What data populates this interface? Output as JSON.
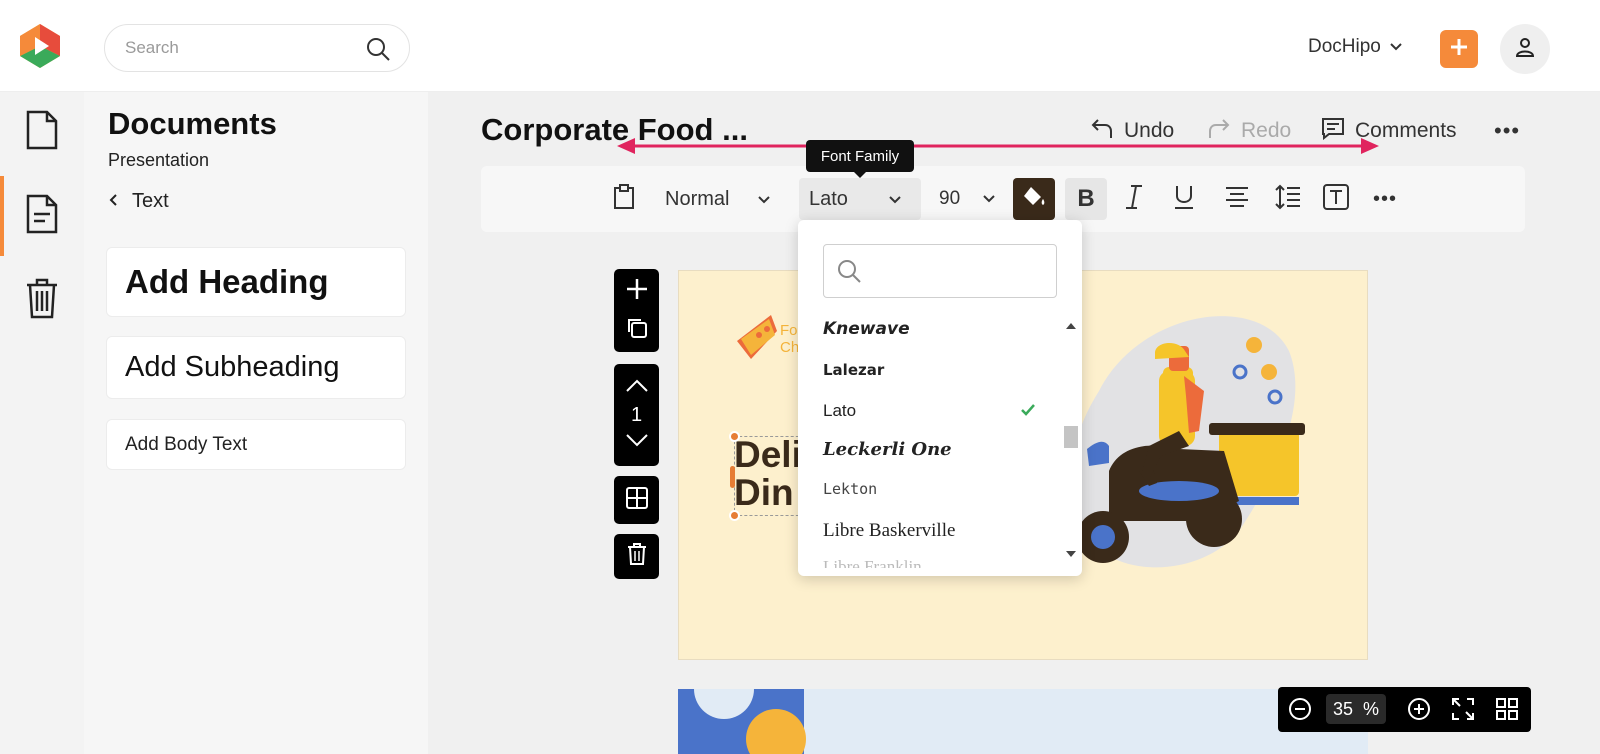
{
  "header": {
    "search_placeholder": "Search",
    "account_name": "DocHipo",
    "accent_color": "#f58a3a"
  },
  "sidebar": {
    "title": "Documents",
    "subtitle": "Presentation",
    "back_label": "Text",
    "cards": {
      "heading": "Add Heading",
      "subheading": "Add Subheading",
      "body": "Add Body Text"
    }
  },
  "editor": {
    "doc_title": "Corporate Food ...",
    "undo_label": "Undo",
    "redo_label": "Redo",
    "comments_label": "Comments"
  },
  "toolbar": {
    "style_value": "Normal",
    "font_value": "Lato",
    "size_value": "90",
    "tooltip": "Font Family"
  },
  "font_dropdown": {
    "search_value": "",
    "items": [
      "Knewave",
      "Lalezar",
      "Lato",
      "Leckerli One",
      "Lekton",
      "Libre Baskerville",
      "Libre Franklin"
    ],
    "selected": "Lato"
  },
  "canvas": {
    "logo_text_line1": "Fo",
    "logo_text_line2": "Ch",
    "headline_line1": "Deli",
    "headline_line2": "Din",
    "page_number": "1",
    "slide_bg_color": "#fdf0cd"
  },
  "zoom": {
    "value": "35",
    "unit": "%"
  }
}
